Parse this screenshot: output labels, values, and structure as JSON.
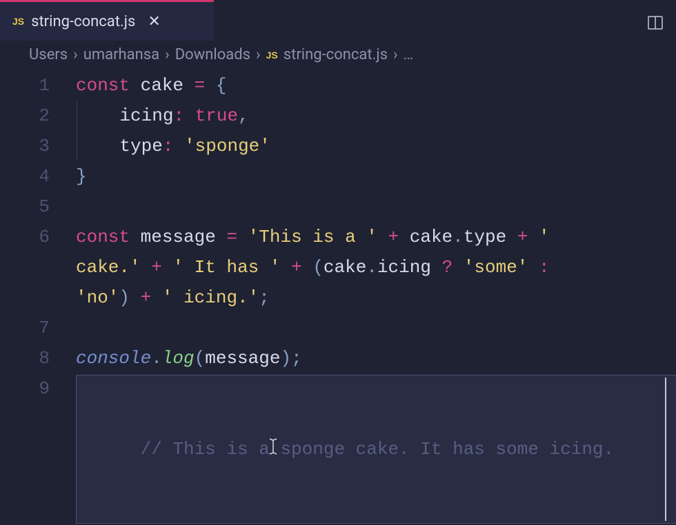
{
  "tab": {
    "icon": "JS",
    "filename": "string-concat.js",
    "close": "✕"
  },
  "breadcrumb": {
    "parts": [
      "Users",
      "umarhansa",
      "Downloads"
    ],
    "fileIcon": "JS",
    "file": "string-concat.js",
    "ellipsis": "…"
  },
  "gutter": [
    "1",
    "2",
    "3",
    "4",
    "5",
    "6",
    "7",
    "8",
    "9"
  ],
  "code": {
    "l1": {
      "const": "const",
      "sp1": " ",
      "ident": "cake",
      "sp2": " ",
      "eq": "=",
      "sp3": " ",
      "brace": "{"
    },
    "l2": {
      "indent": "    ",
      "prop": "icing",
      "colon": ":",
      "sp": " ",
      "bool": "true",
      "comma": ","
    },
    "l3": {
      "indent": "    ",
      "prop": "type",
      "colon": ":",
      "sp": " ",
      "str": "'sponge'"
    },
    "l4": {
      "brace": "}"
    },
    "l5": "",
    "l6a": {
      "const": "const",
      "sp1": " ",
      "ident": "message",
      "sp2": " ",
      "eq": "=",
      "sp3": " ",
      "str1": "'This is a '",
      "sp4": " ",
      "plus1": "+",
      "sp5": " ",
      "obj": "cake",
      "dot": ".",
      "prop": "type",
      "sp6": " ",
      "plus2": "+",
      "sp7": " ",
      "str2": "' "
    },
    "l6b": {
      "str3": "cake.'",
      "sp1": " ",
      "plus1": "+",
      "sp2": " ",
      "str4": "' It has '",
      "sp3": " ",
      "plus2": "+",
      "sp4": " ",
      "paren1": "(",
      "obj": "cake",
      "dot": ".",
      "prop": "icing",
      "sp5": " ",
      "q": "?",
      "sp6": " ",
      "str5": "'some'",
      "sp7": " ",
      "colon": ":",
      "sp8": " "
    },
    "l6c": {
      "str6": "'no'",
      "paren2": ")",
      "sp1": " ",
      "plus": "+",
      "sp2": " ",
      "str7": "' icing.'",
      "semi": ";"
    },
    "l7": "",
    "l8": {
      "console": "console",
      "dot": ".",
      "log": "log",
      "paren1": "(",
      "arg": "message",
      "paren2": ")",
      "semi": ";"
    },
    "l9": {
      "comment": "// This is a sponge cake. It has some icing."
    }
  }
}
